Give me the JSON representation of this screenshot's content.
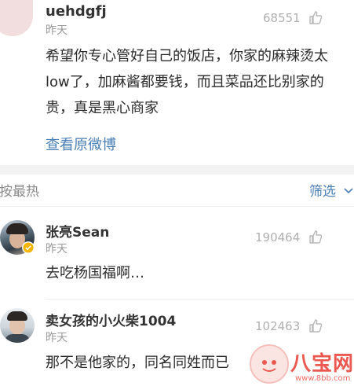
{
  "comments": [
    {
      "username": "uehdgfj",
      "time": "昨天",
      "likes": "68551",
      "text_lines": [
        "希望你专心管好自己的饭店，你家的麻辣烫太",
        "low了，加麻酱都要钱，而且菜品还比别家的",
        "贵，真是黑心商家"
      ],
      "view_original": "查看原微博"
    },
    {
      "username": "张亮Sean",
      "time": "昨天",
      "likes": "190464",
      "text": "去吃杨国福啊…"
    },
    {
      "username": "卖女孩的小火柴1004",
      "time": "昨天",
      "likes": "102463",
      "text": "那不是他家的，同名同姓而已"
    }
  ],
  "sort_bar": {
    "sort_label": "按最热",
    "filter_label": "筛选"
  },
  "watermark": {
    "text": "八宝网",
    "url": "www.8bb.com"
  },
  "colors": {
    "link": "#4a7fb5",
    "verified_badge": "#f5b400",
    "watermark": "#e8473d"
  },
  "icons": [
    "thumbs-up-icon",
    "chevron-down-icon",
    "verified-badge-icon",
    "avatar"
  ]
}
